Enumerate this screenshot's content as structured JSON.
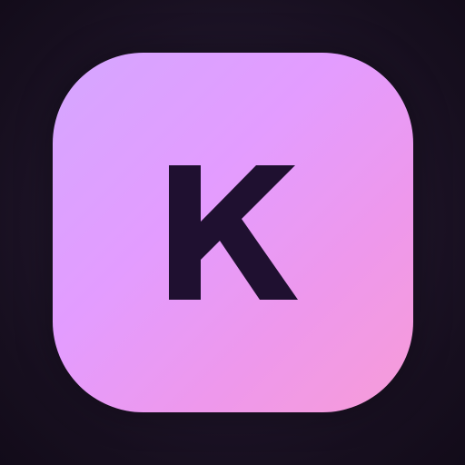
{
  "icon": {
    "letter": "K",
    "name": "k-letter-icon",
    "colors": {
      "background_center": "#2e2140",
      "background_edge": "#120b19",
      "tile_start": "#d5a6ff",
      "tile_mid": "#e39cff",
      "tile_end": "#f79cd8",
      "glyph": "#1f1030"
    }
  }
}
